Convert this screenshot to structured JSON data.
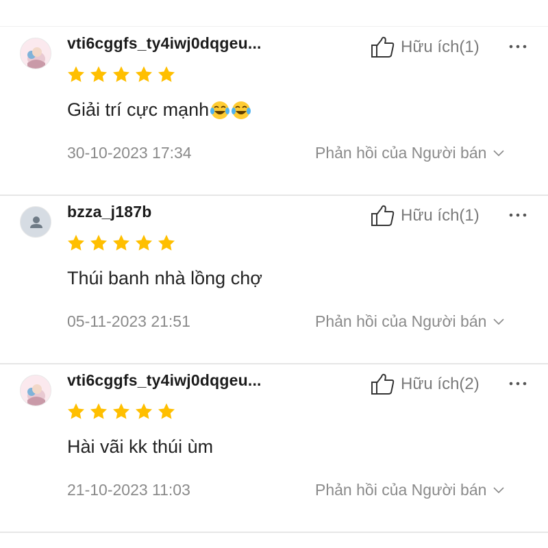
{
  "reviews": [
    {
      "username": "vti6cggfs_ty4iwj0dqgeu...",
      "avatar": "profile-photo",
      "rating": 5,
      "comment": "Giải trí cực mạnh",
      "emojis": [
        "laughing-tears-emoji",
        "laughing-tears-emoji"
      ],
      "date": "30-10-2023 17:34",
      "helpful_label": "Hữu ích(1)",
      "seller_reply_label": "Phản hồi của Người bán"
    },
    {
      "username": "bzza_j187b",
      "avatar": "default-user",
      "rating": 5,
      "comment": "Thúi banh nhà lồng chợ",
      "emojis": [],
      "date": "05-11-2023 21:51",
      "helpful_label": "Hữu ích(1)",
      "seller_reply_label": "Phản hồi của Người bán"
    },
    {
      "username": "vti6cggfs_ty4iwj0dqgeu...",
      "avatar": "profile-photo",
      "rating": 5,
      "comment": "Hài vãi kk thúi ùm",
      "emojis": [],
      "date": "21-10-2023 11:03",
      "helpful_label": "Hữu ích(2)",
      "seller_reply_label": "Phản hồi của Người bán"
    }
  ],
  "icons": {
    "star": "star-icon",
    "helpful": "thumbs-up-icon",
    "more": "more-options-icon",
    "expand": "chevron-down-icon"
  },
  "colors": {
    "star": "#ffbf00",
    "muted_text": "#8a8a8a",
    "divider": "#e6e6e6"
  }
}
